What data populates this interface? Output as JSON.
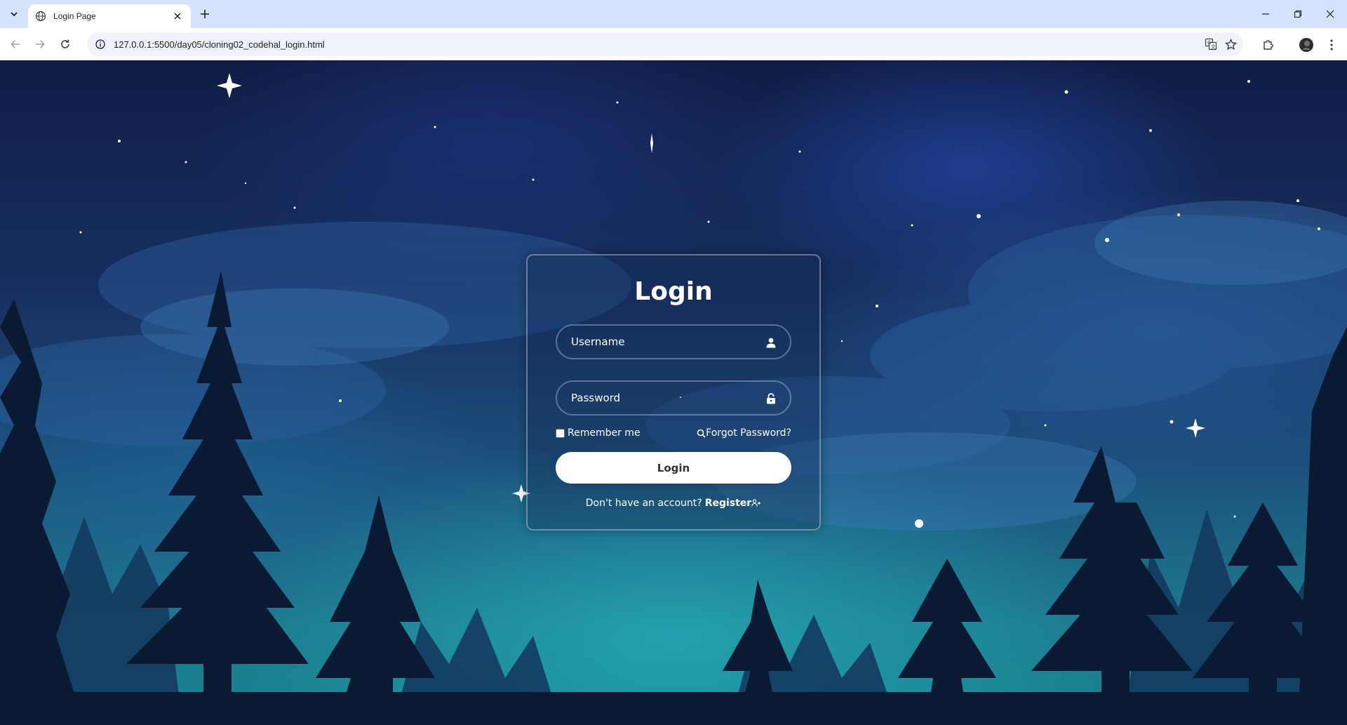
{
  "browser": {
    "tab_title": "Login Page",
    "url": "127.0.0.1:5500/day05/cloning02_codehal_login.html"
  },
  "icons": {
    "tab_favicon": "globe-icon",
    "tab_search": "chevron-down-icon",
    "tab_close": "close-icon",
    "new_tab": "plus-icon",
    "minimize": "minimize-icon",
    "restore": "restore-icon",
    "close_window": "close-icon",
    "back": "arrow-left-icon",
    "forward": "arrow-right-icon",
    "reload": "reload-icon",
    "site_info": "info-icon",
    "translate": "translate-icon",
    "bookmark": "star-icon",
    "extensions": "puzzle-icon",
    "profile": "avatar-icon",
    "menu": "kebab-menu-icon",
    "username_field": "user-icon",
    "password_field": "lock-icon",
    "forgot": "search-icon",
    "register": "user-plus-icon"
  },
  "login": {
    "title": "Login",
    "username_placeholder": "Username",
    "password_placeholder": "Password",
    "remember_label": "Remember me",
    "forgot_label": "Forgot Password?",
    "button_label": "Login",
    "no_account_text": "Don't have an account?",
    "register_label": "Register"
  },
  "colors": {
    "tabstrip": "#d3e3fd",
    "card_border": "rgba(255,255,255,0.35)",
    "button_bg": "#ffffff",
    "button_text": "#333333"
  }
}
